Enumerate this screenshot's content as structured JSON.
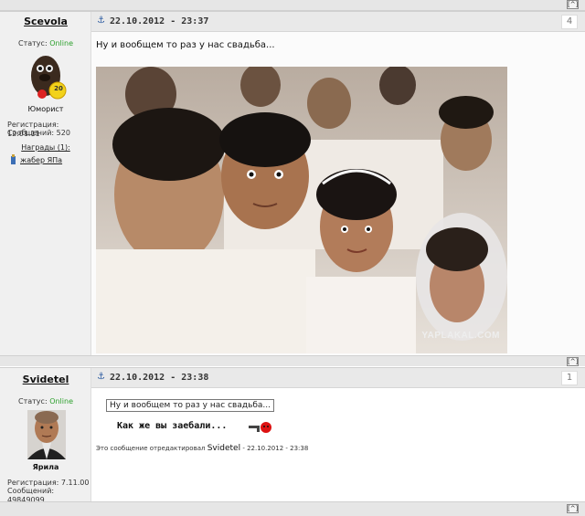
{
  "posts": [
    {
      "username": "Scevola",
      "status_label": "Статус:",
      "status_value": "Online",
      "rank": "Юморист",
      "avatar_badge": "20",
      "registration": "Регистрация: 12.01.11",
      "messages": "Сообщений: 520",
      "awards_label": "Награды (1):",
      "award": "жабер ЯПа",
      "date": "22.10.2012 - 23:37",
      "post_number": "4",
      "text": "Ну и вообщем то раз у нас свадьба...",
      "image_watermark": "YAPLAKAL.COM"
    },
    {
      "username": "Svidetel",
      "status_label": "Статус:",
      "status_value": "Online",
      "rank": "Ярила",
      "registration": "Регистрация: 7.11.00",
      "messages": "Сообщений: 49849099",
      "date": "22.10.2012 - 23:38",
      "post_number": "1",
      "quote": "Ну и вообщем то раз у нас свадьба...",
      "reply": "Как же вы заебали...",
      "edited_prefix": "Это сообщение отредактировал",
      "edited_by": "Svidetel",
      "edited_date": "- 22.10.2012 - 23:38"
    }
  ],
  "ui": {
    "scroll_up": "[^]",
    "anchor_icon": "⚓"
  },
  "colors": {
    "online": "#2ca02c",
    "header_bg": "#e9e9e9",
    "side_bg": "#f0f0f0"
  }
}
